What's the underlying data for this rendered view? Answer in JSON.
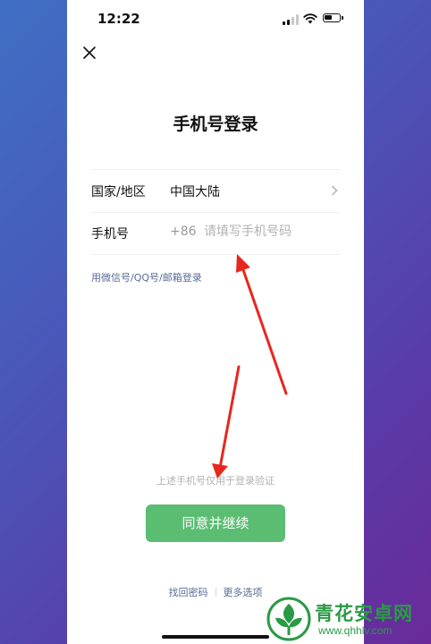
{
  "status_bar": {
    "time": "12:22"
  },
  "page": {
    "title": "手机号登录"
  },
  "country_row": {
    "label": "国家/地区",
    "value": "中国大陆"
  },
  "phone_row": {
    "label": "手机号",
    "prefix": "+86",
    "placeholder": "请填写手机号码"
  },
  "alt_login": "用微信号/QQ号/邮箱登录",
  "notice": "上述手机号仅用于登录验证",
  "agree_button": "同意并继续",
  "footer": {
    "recover_password": "找回密码",
    "more_options": "更多选项"
  },
  "watermark": {
    "name": "青花安卓网",
    "url": "www.qhhlv.com"
  },
  "colors": {
    "accent_green": "#5bbd72",
    "link_blue": "#576b95",
    "annotation_red": "#e8261e",
    "watermark_green": "#2a9a44"
  }
}
